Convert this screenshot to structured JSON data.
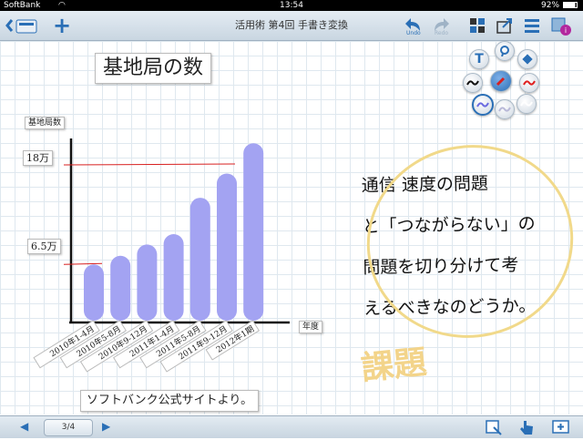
{
  "status": {
    "carrier": "SoftBank",
    "time": "13:54",
    "battery": "92%"
  },
  "toolbar": {
    "title": "活用術 第4回 手書き変換",
    "undo_label": "Undo",
    "redo_label": "Redo"
  },
  "page": {
    "indicator": "3/4"
  },
  "slide": {
    "heading": "基地局の数",
    "caption": "ソフトバンク公式サイトより。",
    "notes": [
      "通信 速度の問題",
      "と「つながらない」の",
      "問題を切り分けて考",
      "えるべきなのどうか。"
    ],
    "highlight": "課題"
  },
  "chart_data": {
    "type": "bar",
    "ylabel": "基地局数",
    "xlabel": "年度",
    "categories": [
      "2010年1-4月",
      "2010年5-8月",
      "2010年9-12月",
      "2011年1-4月",
      "2011年5-8月",
      "2011年9-12月",
      "2012年1期"
    ],
    "values": [
      6.5,
      7.5,
      8.8,
      10.0,
      14.2,
      17.0,
      20.5
    ],
    "ylim": [
      0,
      22
    ],
    "reference_lines": [
      {
        "label": "18万",
        "value": 18
      },
      {
        "label": "6.5万",
        "value": 6.5
      }
    ],
    "bar_color": "#a3a3f2"
  }
}
